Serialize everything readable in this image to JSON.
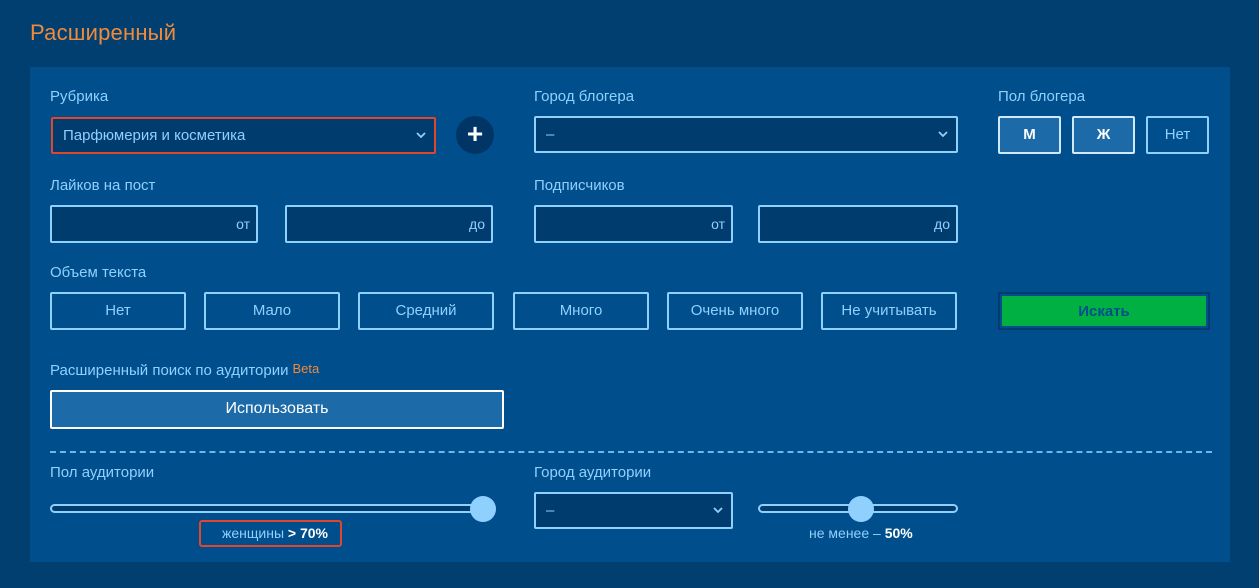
{
  "title": "Расширенный",
  "rubric": {
    "label": "Рубрика",
    "selected": "Парфюмерия и косметика",
    "add_label": "+"
  },
  "blogger_city": {
    "label": "Город блогера",
    "selected": "–"
  },
  "blogger_gender": {
    "label": "Пол блогера",
    "options": [
      "М",
      "Ж",
      "Нет"
    ]
  },
  "likes": {
    "label": "Лайков на пост",
    "from_suffix": "от",
    "to_suffix": "до"
  },
  "subscribers": {
    "label": "Подписчиков",
    "from_suffix": "от",
    "to_suffix": "до"
  },
  "text_volume": {
    "label": "Объем текста",
    "options": [
      "Нет",
      "Мало",
      "Средний",
      "Много",
      "Очень много",
      "Не учитывать"
    ]
  },
  "search_label": "Искать",
  "audience_search": {
    "label": "Расширенный поиск по аудитории",
    "beta": "Beta",
    "use_label": "Использовать"
  },
  "audience_gender": {
    "label": "Пол аудитории",
    "slider_value": 1.0,
    "caption_prefix": "женщины",
    "caption_value": "> 70%"
  },
  "audience_city": {
    "label": "Город аудитории",
    "selected": "–",
    "slider_value": 0.5,
    "caption_prefix": "не менее –",
    "caption_value": "50%"
  },
  "colors": {
    "background": "#003f70",
    "panel": "#004e8c",
    "accent_orange": "#f08a3c",
    "text_blue": "#8fd0ff",
    "search_green": "#00b043",
    "highlight_red": "#e0452e"
  }
}
